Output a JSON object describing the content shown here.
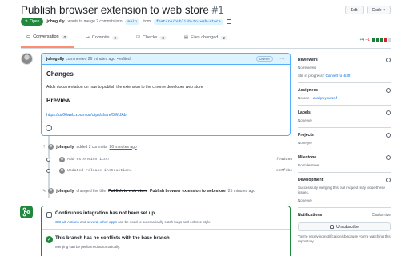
{
  "pr": {
    "title": "Publish browser extension to web store",
    "number": "#1",
    "status": "Open",
    "meta_author": "johngully",
    "meta_wants": "wants to merge 2 commits into",
    "base_branch": "main",
    "meta_from": "from",
    "head_branch": "feature/publish-to-web-store"
  },
  "header_buttons": {
    "edit": "Edit",
    "code": "Code"
  },
  "tabs": [
    {
      "label": "Conversation",
      "count": "0"
    },
    {
      "label": "Commits",
      "count": "2"
    },
    {
      "label": "Checks",
      "count": "0"
    },
    {
      "label": "Files changed",
      "count": "2"
    }
  ],
  "diffstat": {
    "add": "+4",
    "del": "−1"
  },
  "comment": {
    "author": "johngully",
    "action": "commented 26 minutes ago",
    "edited": "• edited",
    "owner_badge": "Owner",
    "menu": "···",
    "heading_changes": "Changes",
    "text": "Adds documentation on how to publish the extension to the chrome developer web store",
    "heading_preview": "Preview",
    "link": "https://us06web.zoom.us/clips/share/5WcfAb"
  },
  "timeline": {
    "commits_author": "johngully",
    "commits_text": "added 2 commits",
    "commits_time": "26 minutes ago",
    "commits": [
      {
        "message": "Add extension icon",
        "sha": "fe4dd85"
      },
      {
        "message": "Updated release instructions",
        "sha": "e87fcbc"
      }
    ],
    "rename_author": "johngully",
    "rename_text": "changed the title",
    "rename_old": "Publish to web store",
    "rename_new": "Publish browser extension to web-store",
    "rename_time": "25 minutes ago"
  },
  "merge": {
    "ci_title": "Continuous integration has not been set up",
    "ci_link1": "GitHub Actions",
    "ci_and": "and",
    "ci_link2": "several other apps",
    "ci_rest": "can be used to automatically catch bugs and enforce style.",
    "ok_title": "This branch has no conflicts with the base branch",
    "ok_sub": "Merging can be performed automatically."
  },
  "sidebar": {
    "reviewers_h": "Reviewers",
    "reviewers_t": "No reviews",
    "reviewers_progress": "Still in progress?",
    "reviewers_link": "Convert to draft",
    "assignees_h": "Assignees",
    "assignees_t": "No one—",
    "assignees_link": "assign yourself",
    "labels_h": "Labels",
    "labels_t": "None yet",
    "projects_h": "Projects",
    "projects_t": "None yet",
    "milestone_h": "Milestone",
    "milestone_t": "No milestone",
    "development_h": "Development",
    "development_t": "Successfully merging this pull request may close these issues.",
    "development_t2": "None yet",
    "notifications_h": "Notifications",
    "notifications_customize": "Customize",
    "unsubscribe": "Unsubscribe",
    "notifications_t": "You're receiving notifications because you're watching this repository."
  }
}
